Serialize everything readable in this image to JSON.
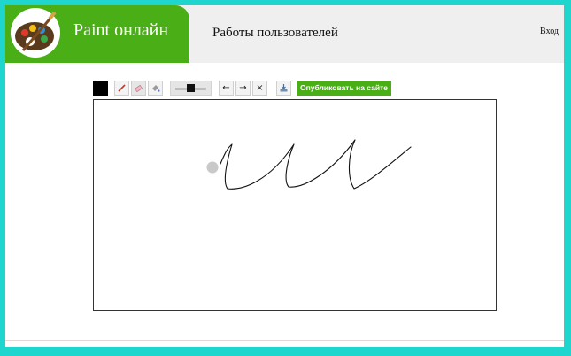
{
  "header": {
    "brand_title": "Paint онлайн",
    "nav_works": "Работы пользователей",
    "nav_login": "Вход"
  },
  "toolbar": {
    "current_color": "#000000",
    "tools": [
      {
        "name": "brush",
        "icon": "brush-icon",
        "selected": false
      },
      {
        "name": "eraser",
        "icon": "eraser-icon",
        "selected": true
      },
      {
        "name": "fill",
        "icon": "paint-bucket-icon",
        "selected": false
      }
    ],
    "undo_icon": "←",
    "redo_icon": "→",
    "clear_icon": "×",
    "download_icon": "download-icon",
    "publish_label": "Опубликовать на сайте"
  },
  "colors": {
    "accent": "#4aae16",
    "border": "#1fd6cf",
    "header_bg": "#efefef"
  }
}
